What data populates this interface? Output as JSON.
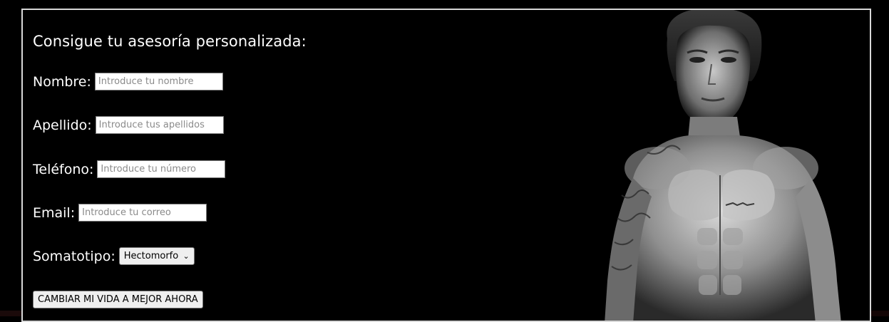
{
  "form": {
    "title": "Consigue tu asesoría personalizada:",
    "fields": {
      "nombre": {
        "label": "Nombre:",
        "placeholder": "Introduce tu nombre"
      },
      "apellido": {
        "label": "Apellido:",
        "placeholder": "Introduce tus apellidos"
      },
      "telefono": {
        "label": "Teléfono:",
        "placeholder": "Introduce tu número"
      },
      "email": {
        "label": "Email:",
        "placeholder": "Introduce tu correo"
      },
      "somatotipo": {
        "label": "Somatotipo:",
        "selected": "Hectomorfo"
      }
    },
    "submit_label": "CAMBIAR MI VIDA A MEJOR AHORA"
  },
  "colors": {
    "background": "#000000",
    "border": "#d8d8d8",
    "text": "#ffffff"
  },
  "icons": {
    "select_arrow": "chevron-down-icon"
  }
}
